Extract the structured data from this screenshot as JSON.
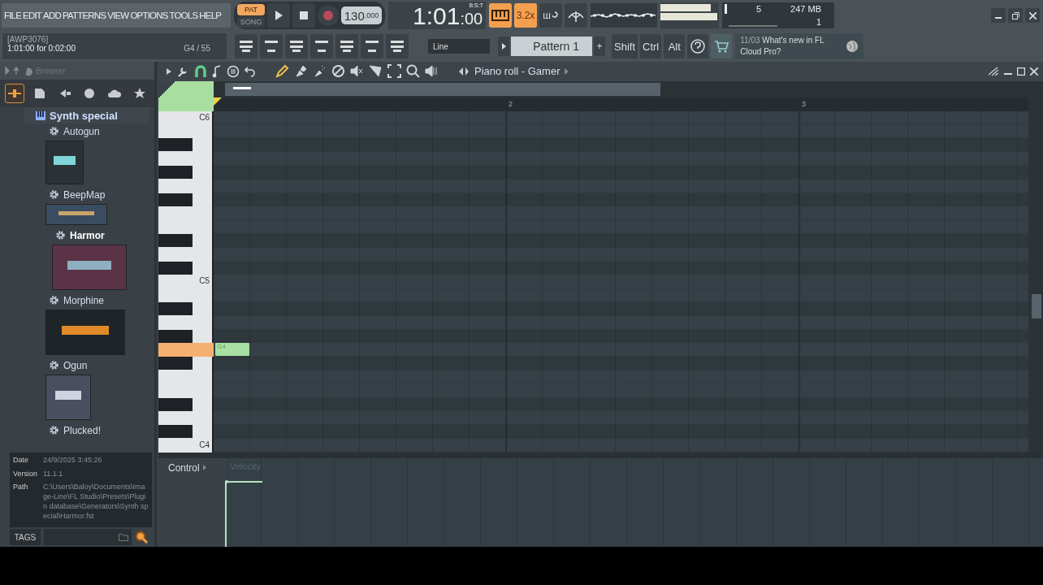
{
  "menu": [
    "FILE",
    "EDIT",
    "ADD",
    "PATTERNS",
    "VIEW",
    "OPTIONS",
    "TOOLS",
    "HELP"
  ],
  "hint": {
    "title": "[AWP3076]",
    "text": "1:01:00 for 0:02:00",
    "note": "G4 / 55"
  },
  "transport": {
    "modes": [
      {
        "label": "PAT",
        "selected": true
      },
      {
        "label": "SONG",
        "selected": false
      }
    ],
    "recording": false,
    "tempo": "130",
    "tempo_decimals": ".000",
    "time": "1:01",
    "time_ticks": ":00",
    "time_unit": "B:S:T"
  },
  "toggles": [
    {
      "label": "3.2x",
      "kind": "speed",
      "on": true
    },
    {
      "label": "ш",
      "kind": "loop",
      "on": false
    }
  ],
  "snap": "Line",
  "pattern": "Pattern 1",
  "plus": "+",
  "modifiers": [
    "Shift",
    "Ctrl",
    "Alt"
  ],
  "monitor": {
    "cpu": "5",
    "memory": "247 MB",
    "polyphony": "1"
  },
  "news": {
    "date": "11/03",
    "text": "What's new in FL Cloud Pro?"
  },
  "browser": {
    "title": "Browser",
    "tabs": [
      {
        "kind": "all",
        "selected": true
      },
      {
        "kind": "files",
        "selected": false
      },
      {
        "kind": "plugins",
        "selected": false
      },
      {
        "kind": "world",
        "selected": false
      },
      {
        "kind": "cloud",
        "selected": false
      },
      {
        "kind": "star",
        "selected": false
      }
    ],
    "folder": "Synth special",
    "items": [
      {
        "name": "Autogun",
        "selected": false,
        "preview": true
      },
      {
        "name": "BeepMap",
        "selected": false,
        "preview": true
      },
      {
        "name": "Harmor",
        "selected": true,
        "preview": true
      },
      {
        "name": "Morphine",
        "selected": false,
        "preview": true
      },
      {
        "name": "Ogun",
        "selected": false,
        "preview": true
      },
      {
        "name": "Plucked!",
        "selected": false,
        "preview": false
      }
    ],
    "info": [
      {
        "label": "Date",
        "value": "24/9/2025 3:45:26"
      },
      {
        "label": "Version",
        "value": "11.1.1"
      },
      {
        "label": "Path",
        "value": "C:\\Users\\Baloy\\Documents\\Image-Line\\FL Studio\\Presets\\Plugin database\\Generators\\Synth special\\Harmor.fst"
      }
    ],
    "tags": "TAGS"
  },
  "piano_roll": {
    "title": "Piano roll - Gamer",
    "snap_on": true,
    "tools": [
      {
        "kind": "pencil",
        "selected": true
      },
      {
        "kind": "paint",
        "selected": false
      },
      {
        "kind": "spray",
        "selected": false
      },
      {
        "kind": "delete",
        "selected": false
      },
      {
        "kind": "mute",
        "selected": false
      },
      {
        "kind": "slice",
        "selected": false
      },
      {
        "kind": "select",
        "selected": false
      },
      {
        "kind": "zoom",
        "selected": false
      },
      {
        "kind": "play",
        "selected": false
      }
    ],
    "bars": [
      "2",
      "3"
    ],
    "octaves": [
      "C6",
      "C5",
      "C4"
    ],
    "notes": [
      {
        "label": "G4",
        "selected": false
      }
    ],
    "control": "Control",
    "control_target": "Velocity"
  }
}
